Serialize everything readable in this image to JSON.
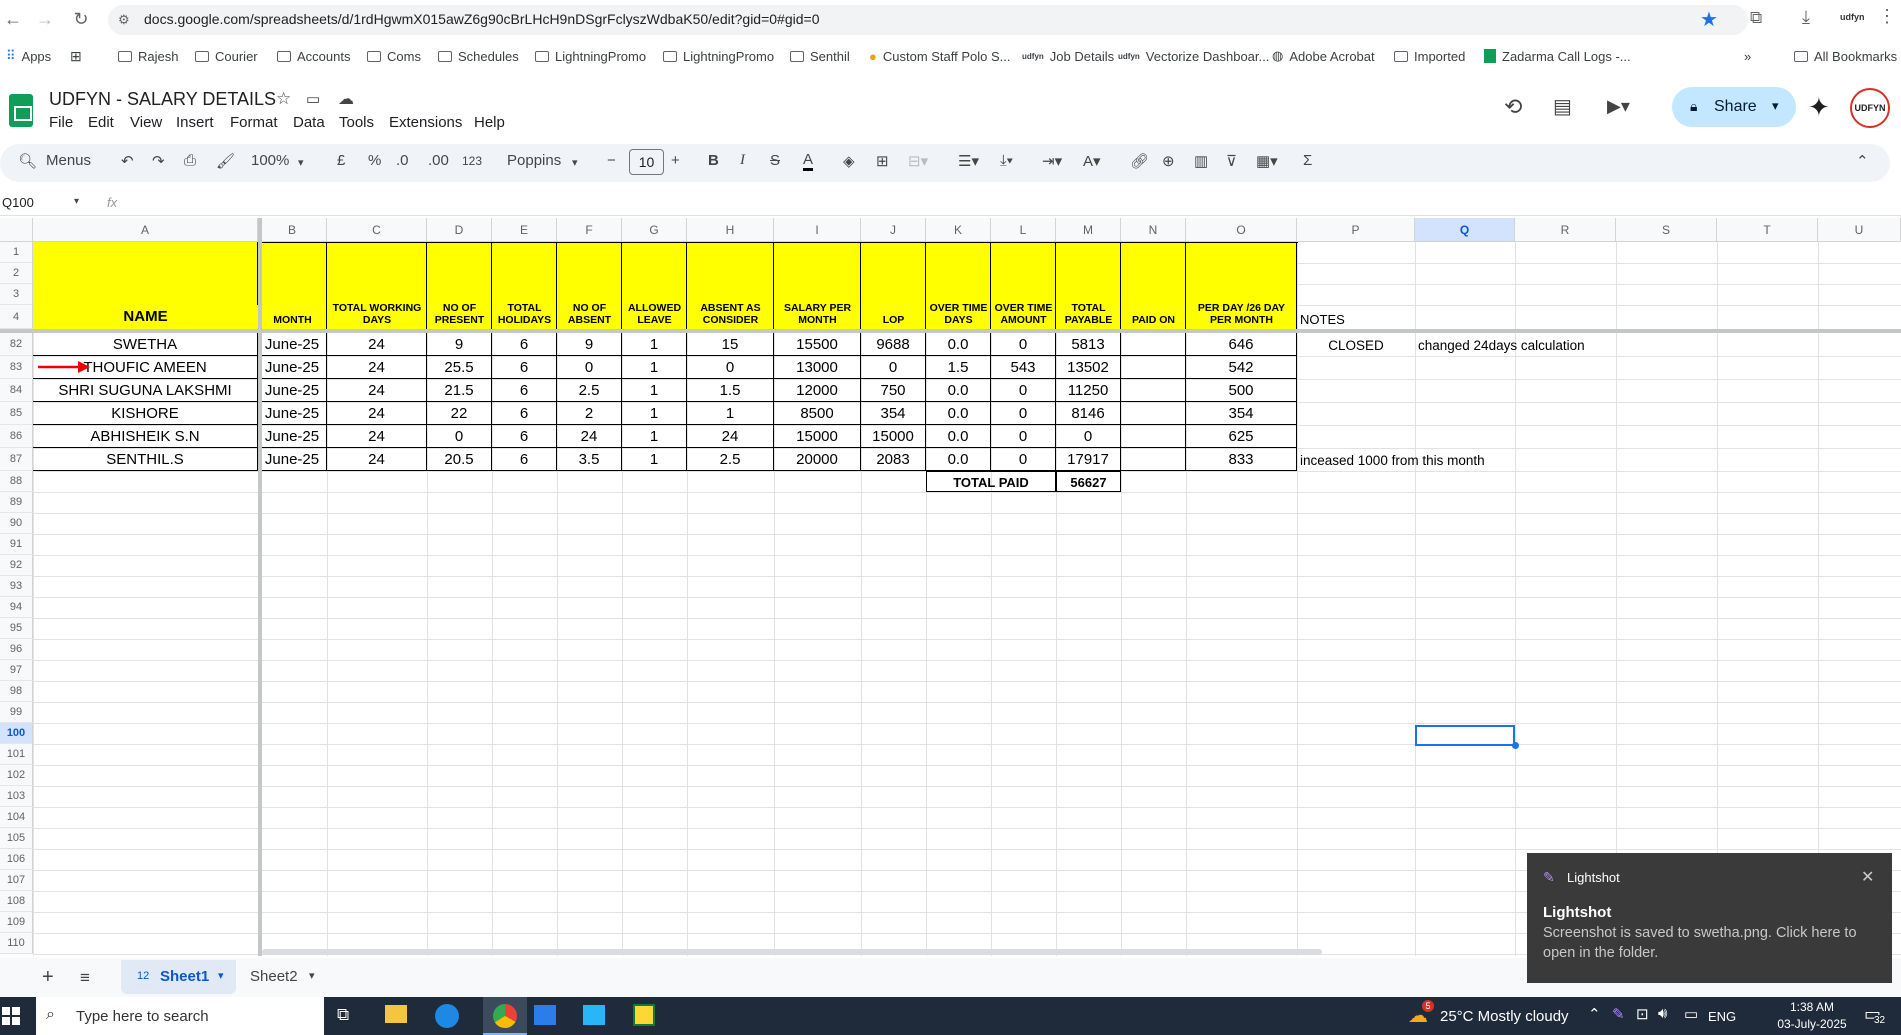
{
  "browser": {
    "url": "docs.google.com/spreadsheets/d/1rdHgwmX015awZ6g90cBrLHcH9nDSgrFclyszWdbaK50/edit?gid=0#gid=0",
    "bookmarks": [
      "Apps",
      "Rajesh",
      "Courier",
      "Accounts",
      "Coms",
      "Schedules",
      "LightningPromo",
      "LightningPromo",
      "Senthil",
      "Custom Staff Polo S...",
      "Job Details",
      "Vectorize Dashboar...",
      "Adobe Acrobat",
      "Imported",
      "Zadarma Call Logs -...",
      "All Bookmarks"
    ]
  },
  "doc": {
    "title": "UDFYN - SALARY DETAILS",
    "menus": [
      "File",
      "Edit",
      "View",
      "Insert",
      "Format",
      "Data",
      "Tools",
      "Extensions",
      "Help"
    ],
    "share": "Share",
    "avatar": "UDFYN"
  },
  "toolbar": {
    "search": "Menus",
    "zoom": "100%",
    "currency": "£",
    "percent": "%",
    "dec_dec": ".0",
    "dec_inc": ".00",
    "format123": "123",
    "font": "Poppins",
    "font_size": "10"
  },
  "formula": {
    "namebox": "Q100",
    "fx": "fx"
  },
  "columns": [
    "A",
    "B",
    "C",
    "D",
    "E",
    "F",
    "G",
    "H",
    "I",
    "J",
    "K",
    "L",
    "M",
    "N",
    "O",
    "P",
    "Q",
    "R",
    "S",
    "T",
    "U"
  ],
  "headers": [
    "NAME",
    "MONTH",
    "TOTAL WORKING DAYS",
    "NO OF PRESENT",
    "TOTAL HOLIDAYS",
    "NO OF ABSENT",
    "ALLOWED LEAVE",
    "ABSENT AS CONSIDER",
    "SALARY PER MONTH",
    "LOP",
    "OVER TIME DAYS",
    "OVER TIME AMOUNT",
    "TOTAL PAYABLE",
    "PAID ON",
    "PER DAY /26 DAY PER MONTH",
    "NOTES"
  ],
  "rows": [
    {
      "n": "82",
      "cells": [
        "SWETHA",
        "June-25",
        "24",
        "9",
        "6",
        "9",
        "1",
        "15",
        "15500",
        "9688",
        "0.0",
        "0",
        "5813",
        "",
        "646"
      ],
      "p": "CLOSED",
      "q": "changed 24days calculation"
    },
    {
      "n": "83",
      "cells": [
        "THOUFIC AMEEN",
        "June-25",
        "24",
        "25.5",
        "6",
        "0",
        "1",
        "0",
        "13000",
        "0",
        "1.5",
        "543",
        "13502",
        "",
        "542"
      ],
      "p": "",
      "q": ""
    },
    {
      "n": "84",
      "cells": [
        "SHRI SUGUNA LAKSHMI",
        "June-25",
        "24",
        "21.5",
        "6",
        "2.5",
        "1",
        "1.5",
        "12000",
        "750",
        "0.0",
        "0",
        "11250",
        "",
        "500"
      ],
      "p": "",
      "q": ""
    },
    {
      "n": "85",
      "cells": [
        "KISHORE",
        "June-25",
        "24",
        "22",
        "6",
        "2",
        "1",
        "1",
        "8500",
        "354",
        "0.0",
        "0",
        "8146",
        "",
        "354"
      ],
      "p": "",
      "q": ""
    },
    {
      "n": "86",
      "cells": [
        "ABHISHEIK S.N",
        "June-25",
        "24",
        "0",
        "6",
        "24",
        "1",
        "24",
        "15000",
        "15000",
        "0.0",
        "0",
        "0",
        "",
        "625"
      ],
      "p": "",
      "q": ""
    },
    {
      "n": "87",
      "cells": [
        "SENTHIL.S",
        "June-25",
        "24",
        "20.5",
        "6",
        "3.5",
        "1",
        "2.5",
        "20000",
        "2083",
        "0.0",
        "0",
        "17917",
        "",
        "833"
      ],
      "p": "inceased 1000  from this month",
      "q": ""
    }
  ],
  "total": {
    "label": "TOTAL PAID",
    "value": "56627"
  },
  "row_numbers_top": [
    "1",
    "2",
    "3",
    "4"
  ],
  "row_numbers_bottom": [
    "88",
    "89",
    "90",
    "91",
    "92",
    "93",
    "94",
    "95",
    "96",
    "97",
    "98",
    "99",
    "100",
    "101",
    "102",
    "103",
    "104",
    "105",
    "106",
    "107",
    "108",
    "109",
    "110"
  ],
  "sheets": {
    "count": "12",
    "tabs": [
      "Sheet1",
      "Sheet2"
    ]
  },
  "toast": {
    "app": "Lightshot",
    "title": "Lightshot",
    "message": "Screenshot is saved to swetha.png. Click here to open in the folder."
  },
  "taskbar": {
    "search": "Type here to search",
    "weather": "25°C  Mostly cloudy",
    "lang": "ENG",
    "time": "1:38 AM",
    "date": "03-July-2025",
    "notif": "32",
    "weather_badge": "5"
  }
}
